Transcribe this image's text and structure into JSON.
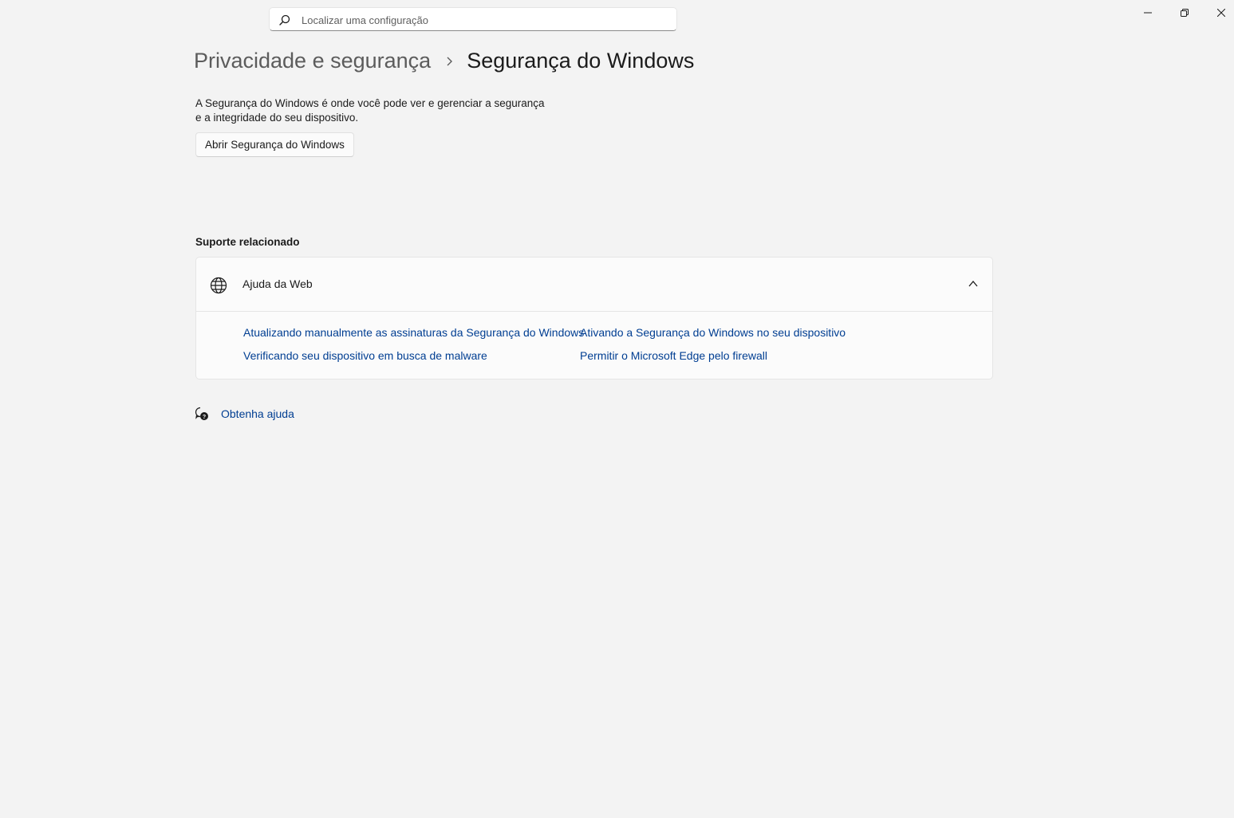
{
  "search": {
    "placeholder": "Localizar uma configuração",
    "icon": "search-icon"
  },
  "window_controls": {
    "minimize_icon": "minimize-icon",
    "restore_icon": "restore-icon",
    "close_icon": "close-icon"
  },
  "breadcrumb": {
    "parent": "Privacidade e segurança",
    "current": "Segurança do Windows"
  },
  "description": {
    "line1": "A Segurança do Windows é onde você pode ver e gerenciar a segurança",
    "line2": "e a integridade do seu dispositivo."
  },
  "open_button": {
    "label": "Abrir Segurança do Windows"
  },
  "related_support": {
    "title": "Suporte relacionado",
    "card": {
      "icon": "globe-icon",
      "label": "Ajuda da Web",
      "expanded": true,
      "links": [
        "Atualizando manualmente as assinaturas da Segurança do Windows",
        "Ativando a Segurança do Windows no seu dispositivo",
        "Verificando seu dispositivo em busca de malware",
        "Permitir o Microsoft Edge pelo firewall"
      ]
    }
  },
  "get_help": {
    "icon": "help-chat-icon",
    "label": "Obtenha ajuda"
  },
  "colors": {
    "background": "#f3f3f3",
    "link": "#003e92",
    "card": "#fbfbfb"
  }
}
